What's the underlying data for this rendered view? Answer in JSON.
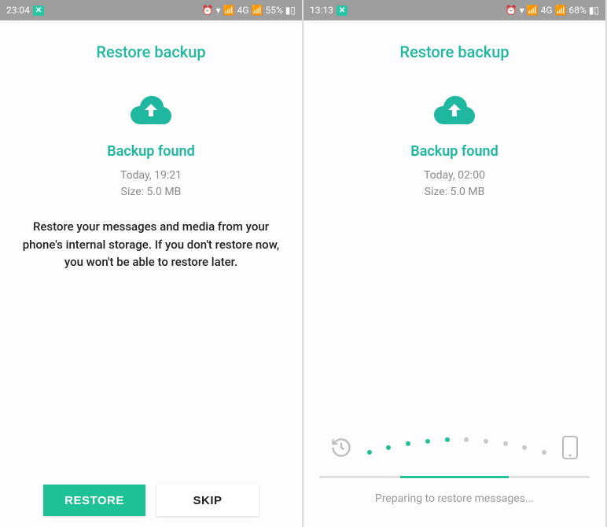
{
  "screen1": {
    "status": {
      "time": "23:04",
      "network": "4G",
      "battery": "55%"
    },
    "title": "Restore backup",
    "backup_found": "Backup found",
    "backup_time": "Today, 19:21",
    "backup_size": "Size: 5.0 MB",
    "description": "Restore your messages and media from your phone's internal storage. If you don't restore now, you won't be able to restore later.",
    "restore_label": "RESTORE",
    "skip_label": "SKIP"
  },
  "screen2": {
    "status": {
      "time": "13:13",
      "network": "4G",
      "battery": "68%"
    },
    "title": "Restore backup",
    "backup_found": "Backup found",
    "backup_time": "Today, 02:00",
    "backup_size": "Size: 5.0 MB",
    "progress_text": "Preparing to restore messages..."
  },
  "colors": {
    "accent": "#1fc296",
    "muted": "#8a8a8a"
  }
}
